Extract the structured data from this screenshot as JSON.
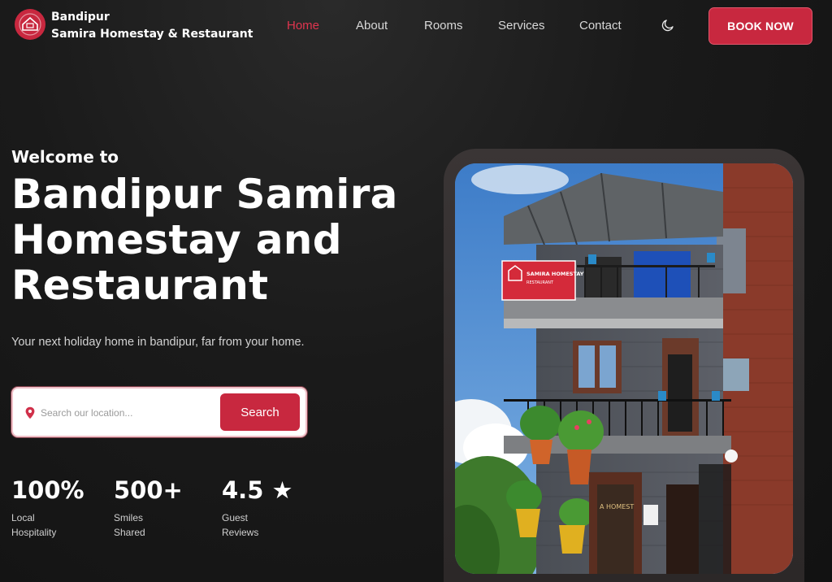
{
  "nav": {
    "brand_line1": "Bandipur",
    "brand_line2": "Samira Homestay & Restaurant",
    "items": [
      {
        "label": "Home",
        "active": true
      },
      {
        "label": "About",
        "active": false
      },
      {
        "label": "Rooms",
        "active": false
      },
      {
        "label": "Services",
        "active": false
      },
      {
        "label": "Contact",
        "active": false
      }
    ],
    "theme_icon": "moon-icon",
    "book_label": "BOOK NOW"
  },
  "hero": {
    "welcome": "Welcome to",
    "title_lines": [
      "Bandipur Samira",
      "Homestay and",
      "Restaurant"
    ],
    "subtitle": "Your next holiday home in bandipur, far from your home."
  },
  "search": {
    "placeholder": "Search our location...",
    "value": "",
    "button_label": "Search",
    "icon": "location-pin-icon"
  },
  "stats": [
    {
      "value": "100%",
      "label_lines": [
        "Local",
        "Hospitality"
      ]
    },
    {
      "value": "500+",
      "label_lines": [
        "Smiles",
        "Shared"
      ]
    },
    {
      "value": "4.5 ★",
      "label_lines": [
        "Guest",
        "Reviews"
      ]
    }
  ],
  "photo": {
    "sign_line1": "SAMIRA HOMESTAY",
    "sign_line2": "RESTAURANT",
    "door_sign": "A HOMEST"
  },
  "colors": {
    "accent": "#c8283f",
    "background": "#1a1a1a"
  }
}
